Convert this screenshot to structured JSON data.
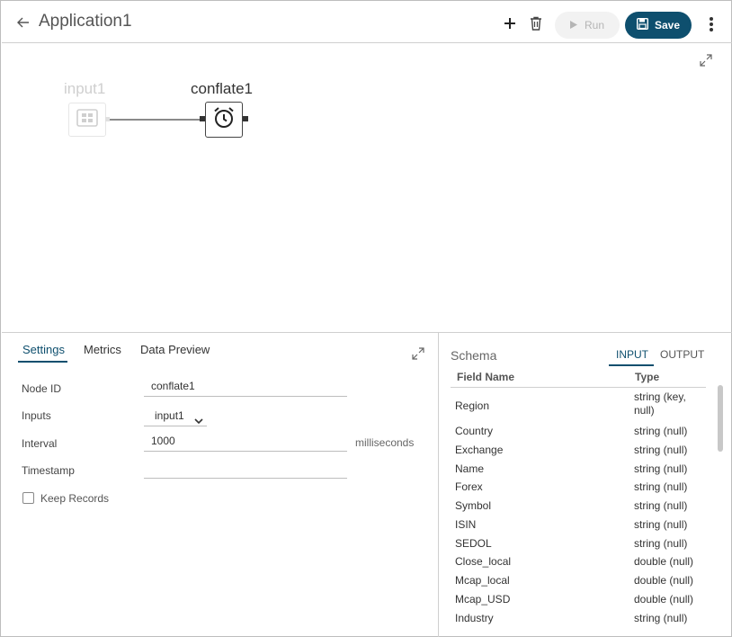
{
  "header": {
    "title": "Application1",
    "run_label": "Run",
    "save_label": "Save"
  },
  "canvas": {
    "nodes": [
      {
        "label": "input1",
        "state": "inactive"
      },
      {
        "label": "conflate1",
        "state": "active"
      }
    ]
  },
  "settings": {
    "tabs": [
      "Settings",
      "Metrics",
      "Data Preview"
    ],
    "active_tab": "Settings",
    "fields": {
      "node_id_label": "Node ID",
      "node_id_value": "conflate1",
      "inputs_label": "Inputs",
      "inputs_value": "input1",
      "interval_label": "Interval",
      "interval_value": "1000",
      "interval_unit": "milliseconds",
      "timestamp_label": "Timestamp",
      "timestamp_value": ""
    },
    "keep_records_label": "Keep Records",
    "keep_records_checked": false
  },
  "schema": {
    "title": "Schema",
    "tabs": [
      "INPUT",
      "OUTPUT"
    ],
    "active_tab": "INPUT",
    "columns": [
      "Field Name",
      "Type"
    ],
    "rows": [
      {
        "name": "Region",
        "type": "string (key, null)"
      },
      {
        "name": "Country",
        "type": "string (null)"
      },
      {
        "name": "Exchange",
        "type": "string (null)"
      },
      {
        "name": "Name",
        "type": "string (null)"
      },
      {
        "name": "Forex",
        "type": "string (null)"
      },
      {
        "name": "Symbol",
        "type": "string (null)"
      },
      {
        "name": "ISIN",
        "type": "string (null)"
      },
      {
        "name": "SEDOL",
        "type": "string (null)"
      },
      {
        "name": "Close_local",
        "type": "double (null)"
      },
      {
        "name": "Mcap_local",
        "type": "double (null)"
      },
      {
        "name": "Mcap_USD",
        "type": "double (null)"
      },
      {
        "name": "Industry",
        "type": "string (null)"
      }
    ]
  },
  "colors": {
    "accent": "#0e4f6e",
    "disabled_bg": "#f2f2f2",
    "disabled_text": "#b5b5b5"
  },
  "icons": [
    "back-arrow-icon",
    "plus-icon",
    "trash-icon",
    "play-icon",
    "save-icon",
    "kebab-icon",
    "expand-icon",
    "input-node-icon",
    "alarm-clock-icon",
    "chevron-down-icon"
  ]
}
